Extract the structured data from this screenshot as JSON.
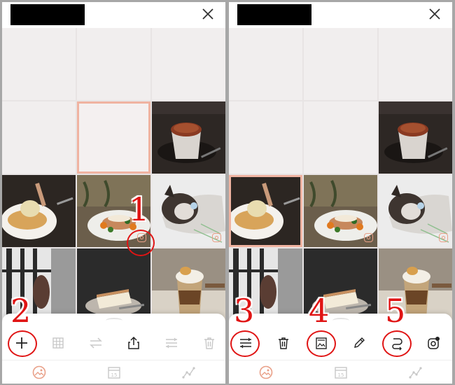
{
  "annotations": {
    "n1": "1",
    "n2": "2",
    "n3": "3",
    "n4": "4",
    "n5": "5"
  },
  "tabs": {
    "calendar_day": "15"
  },
  "icons": {
    "close": "close-icon",
    "add": "plus-icon",
    "grid": "grid-icon",
    "swap": "swap-icon",
    "share": "share-icon",
    "adjust": "adjust-icon",
    "delete": "trash-icon",
    "image": "image-icon",
    "pen": "pen-icon",
    "route": "route-icon",
    "instagram": "instagram-icon",
    "photos_tab": "photos-icon",
    "calendar_tab": "calendar-icon",
    "stats_tab": "chart-icon"
  },
  "colors": {
    "accent": "#f0b3a1",
    "annotation_red": "#e01414",
    "inactive_icon": "#c8c8c8",
    "active_icon": "#222222"
  }
}
